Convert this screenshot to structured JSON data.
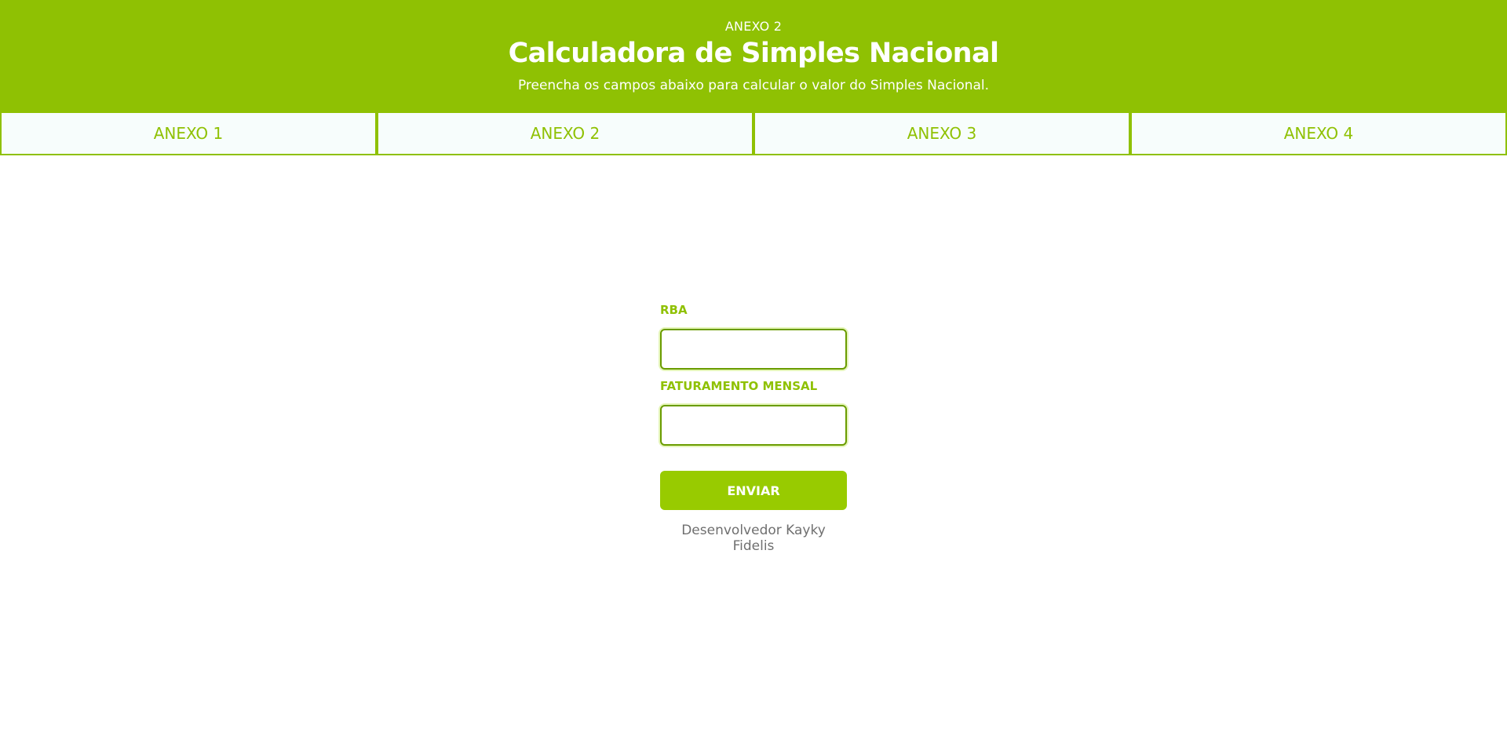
{
  "header": {
    "eyebrow": "ANEXO 2",
    "title": "Calculadora de Simples Nacional",
    "subtitle": "Preencha os campos abaixo para calcular o valor do Simples Nacional."
  },
  "tabs": [
    {
      "label": "ANEXO 1"
    },
    {
      "label": "ANEXO 2"
    },
    {
      "label": "ANEXO 3"
    },
    {
      "label": "ANEXO 4"
    }
  ],
  "form": {
    "rba_label": "RBA",
    "rba_value": "",
    "faturamento_label": "FATURAMENTO MENSAL",
    "faturamento_value": "",
    "submit_label": "ENVIAR"
  },
  "footer": {
    "credit": "Desenvolvedor Kayky Fidelis"
  },
  "colors": {
    "brand_green": "#8fc103",
    "button_green": "#98cb00",
    "tab_background": "#f7fdfc",
    "credit_gray": "#6f6f6f"
  }
}
